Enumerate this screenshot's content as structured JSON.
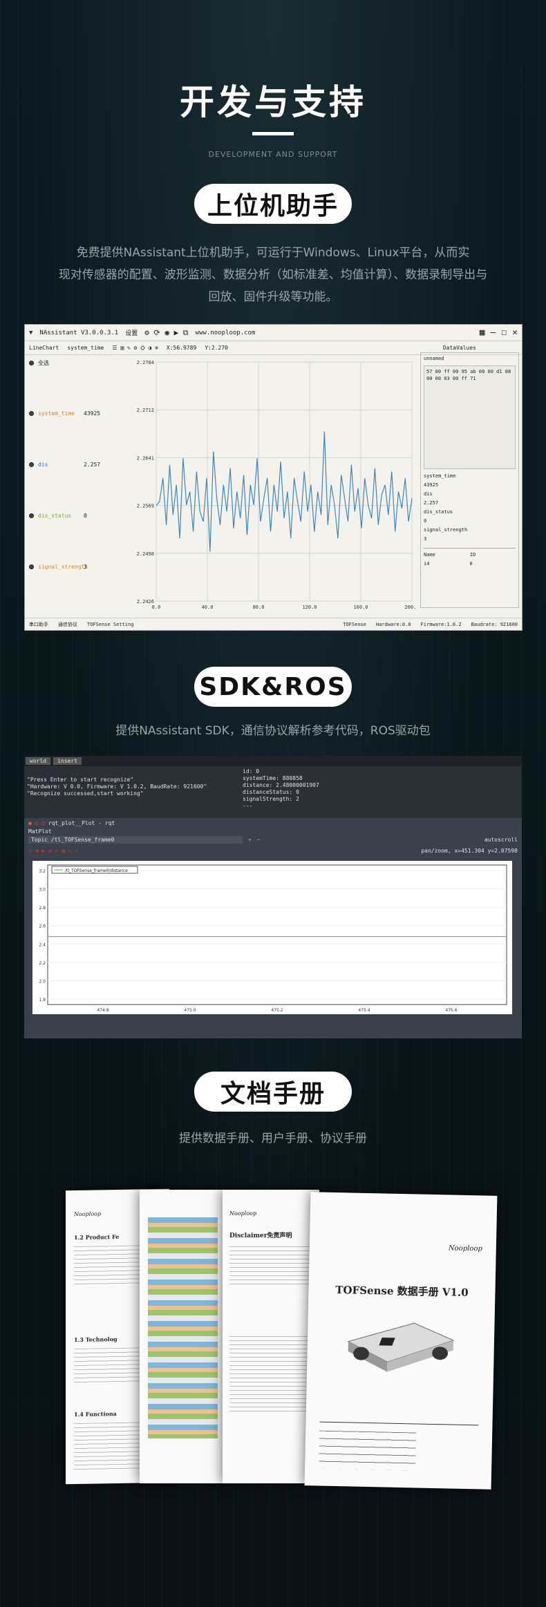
{
  "header": {
    "title": "开发与支持",
    "subtitle": "DEVELOPMENT AND SUPPORT"
  },
  "section1": {
    "pill": "上位机助手",
    "desc_lines": [
      "免费提供NAssistant上位机助手，可运行于Windows、Linux平台，从而实",
      "现对传感器的配置、波形监测、数据分析（如标准差、均值计算）、数据录制导出与",
      "回放、固件升级等功能。"
    ],
    "app": {
      "title": "NAssistant V3.0.0.3.1",
      "menu": "设置",
      "url": "www.nooploop.com",
      "chart_tab": "LineChart",
      "x_var": "system_time",
      "cursor_x": "X:56.9789",
      "cursor_y": "Y:2.270",
      "datavalues_tab": "DataValues",
      "select_all": "全选",
      "vars": [
        {
          "name": "system_time",
          "value": "43925",
          "color": "#c08a2a"
        },
        {
          "name": "dis",
          "value": "2.257",
          "color": "#2a7ab0"
        },
        {
          "name": "dis_status",
          "value": "0",
          "color": "#7aaa3a"
        },
        {
          "name": "signal_strength",
          "value": "3",
          "color": "#d0902a"
        }
      ],
      "unnamed": "unnamed",
      "hex": "57 00 ff 00 95 ab 00 00 d1 08 00 00 03 00 ff 71",
      "right_fields": [
        "system_time",
        "43925",
        "dis",
        "2.257",
        "dis_status",
        "0",
        "signal_strength",
        "3"
      ],
      "table_head": [
        "Name",
        "ID"
      ],
      "table_row": [
        "i4",
        "0"
      ],
      "bottom_buttons": [
        "串口助手",
        "通信协议",
        "TOFSense Setting"
      ],
      "status": [
        "TOFSense",
        "Hardware:0.0",
        "Firmware:1.0.2",
        "Baudrate: 921600"
      ]
    }
  },
  "chart_data": {
    "type": "line",
    "x_ticks": [
      "0.0",
      "40.0",
      "80.0",
      "120.0",
      "160.0",
      "200.0"
    ],
    "y_ticks": [
      "2.2784",
      "2.2712",
      "2.2641",
      "2.2569",
      "2.2498",
      "2.2426"
    ],
    "ylim": [
      2.2426,
      2.2784
    ],
    "xlim": [
      0,
      200
    ],
    "series": [
      {
        "name": "dis",
        "color": "#3f86b8",
        "values": [
          2.2569,
          2.2575,
          2.261,
          2.254,
          2.263,
          2.2555,
          2.26,
          2.252,
          2.264,
          2.257,
          2.259,
          2.253,
          2.262,
          2.256,
          2.2545,
          2.261,
          2.25,
          2.265,
          2.258,
          2.254,
          2.26,
          2.256,
          2.2625,
          2.2535,
          2.259,
          2.255,
          2.2615,
          2.2525,
          2.26,
          2.257,
          2.264,
          2.2545,
          2.258,
          2.261,
          2.253,
          2.26,
          2.256,
          2.2635,
          2.255,
          2.259,
          2.252,
          2.261,
          2.2575,
          2.2545,
          2.262,
          2.256,
          2.26,
          2.253,
          2.259,
          2.2555,
          2.268,
          2.254,
          2.26,
          2.257,
          2.252,
          2.2615,
          2.258,
          2.2545,
          2.263,
          2.256,
          2.2595,
          2.2535,
          2.261,
          2.257,
          2.255,
          2.2625,
          2.254,
          2.2585,
          2.26,
          2.2555,
          2.262,
          2.253,
          2.259,
          2.2565,
          2.261,
          2.2545,
          2.258
        ]
      }
    ]
  },
  "section2": {
    "pill": "SDK&ROS",
    "desc": "提供NAssistant SDK，通信协议解析参考代码，ROS驱动包",
    "term_lines": [
      "\"Press Enter to start recognize\"",
      "\"Hardware: V 0.0, Firmware: V 1.0.2, BaudRate: 921600\"",
      "\"Recognize successed,start working\""
    ],
    "msg_lines": [
      "id: 0",
      "systemTime: 880858",
      "distance: 2.48000001907",
      "distanceStatus: 0",
      "signalStrength: 2",
      "---"
    ],
    "tabs": [
      "world",
      "insert"
    ],
    "rqt_title": "rqt_plot__Plot - rqt",
    "matplot": "MatPlot",
    "topic": "Topic /tl_TOFSense_frame0",
    "autoscroll": "autoscroll",
    "coord": "pan/zoom, x=451.304     y=2.07598",
    "legend": "/tl_TOFSense_frame0/distance",
    "x_ticks": [
      "474.8",
      "475.0",
      "475.2",
      "475.4",
      "475.6"
    ],
    "y_ticks": [
      "3.2",
      "3.0",
      "2.8",
      "2.6",
      "2.4",
      "2.2",
      "2.0",
      "1.8"
    ]
  },
  "section3": {
    "pill": "文档手册",
    "desc": "提供数据手册、用户手册、协议手册",
    "doc_title": "TOFSense 数据手册 V1.0",
    "disclaimer": "Disclaimer免责声明",
    "brand": "Nooploop",
    "sec_a": "1.2 Product Fe",
    "sec_b": "1.3 Technolog",
    "sec_c": "1.4 Functiona"
  }
}
